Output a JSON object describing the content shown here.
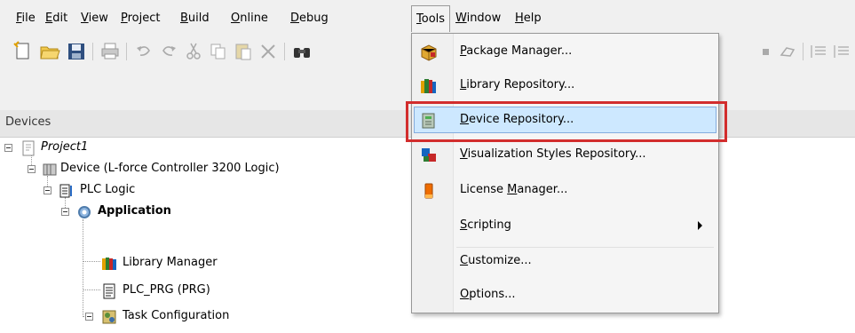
{
  "menubar": {
    "items": [
      {
        "pre": "",
        "ul": "F",
        "post": "ile"
      },
      {
        "pre": "",
        "ul": "E",
        "post": "dit"
      },
      {
        "pre": "",
        "ul": "V",
        "post": "iew"
      },
      {
        "pre": "",
        "ul": "P",
        "post": "roject"
      },
      {
        "pre": "",
        "ul": "B",
        "post": "uild"
      },
      {
        "pre": "",
        "ul": "O",
        "post": "nline"
      },
      {
        "pre": "",
        "ul": "D",
        "post": "ebug"
      },
      {
        "pre": "",
        "ul": "T",
        "post": "ools"
      },
      {
        "pre": "",
        "ul": "W",
        "post": "indow"
      },
      {
        "pre": "",
        "ul": "H",
        "post": "elp"
      }
    ]
  },
  "devices_panel": {
    "title": "Devices"
  },
  "tree": {
    "project": "Project1",
    "device": "Device (L-force Controller 3200 Logic)",
    "plc_logic": "PLC Logic",
    "application": "Application",
    "library_manager": "Library Manager",
    "plc_prg": "PLC_PRG (PRG)",
    "task_configuration": "Task Configuration"
  },
  "tools_menu": {
    "items": [
      {
        "pre": "",
        "ul": "P",
        "post": "ackage Manager...",
        "icon": "package-icon"
      },
      {
        "pre": "",
        "ul": "L",
        "post": "ibrary Repository...",
        "icon": "books-icon"
      },
      {
        "pre": "",
        "ul": "D",
        "post": "evice Repository...",
        "icon": "device-icon"
      },
      {
        "pre": "",
        "ul": "V",
        "post": "isualization Styles Repository...",
        "icon": "visualization-icon"
      },
      {
        "pre": "License ",
        "ul": "M",
        "post": "anager...",
        "icon": "license-icon"
      },
      {
        "pre": "",
        "ul": "S",
        "post": "cripting",
        "icon": ""
      },
      {
        "pre": "",
        "ul": "C",
        "post": "ustomize...",
        "icon": ""
      },
      {
        "pre": "",
        "ul": "O",
        "post": "ptions...",
        "icon": ""
      }
    ]
  },
  "colors": {
    "selection": "#cde8ff",
    "highlight": "#d22d2d"
  }
}
